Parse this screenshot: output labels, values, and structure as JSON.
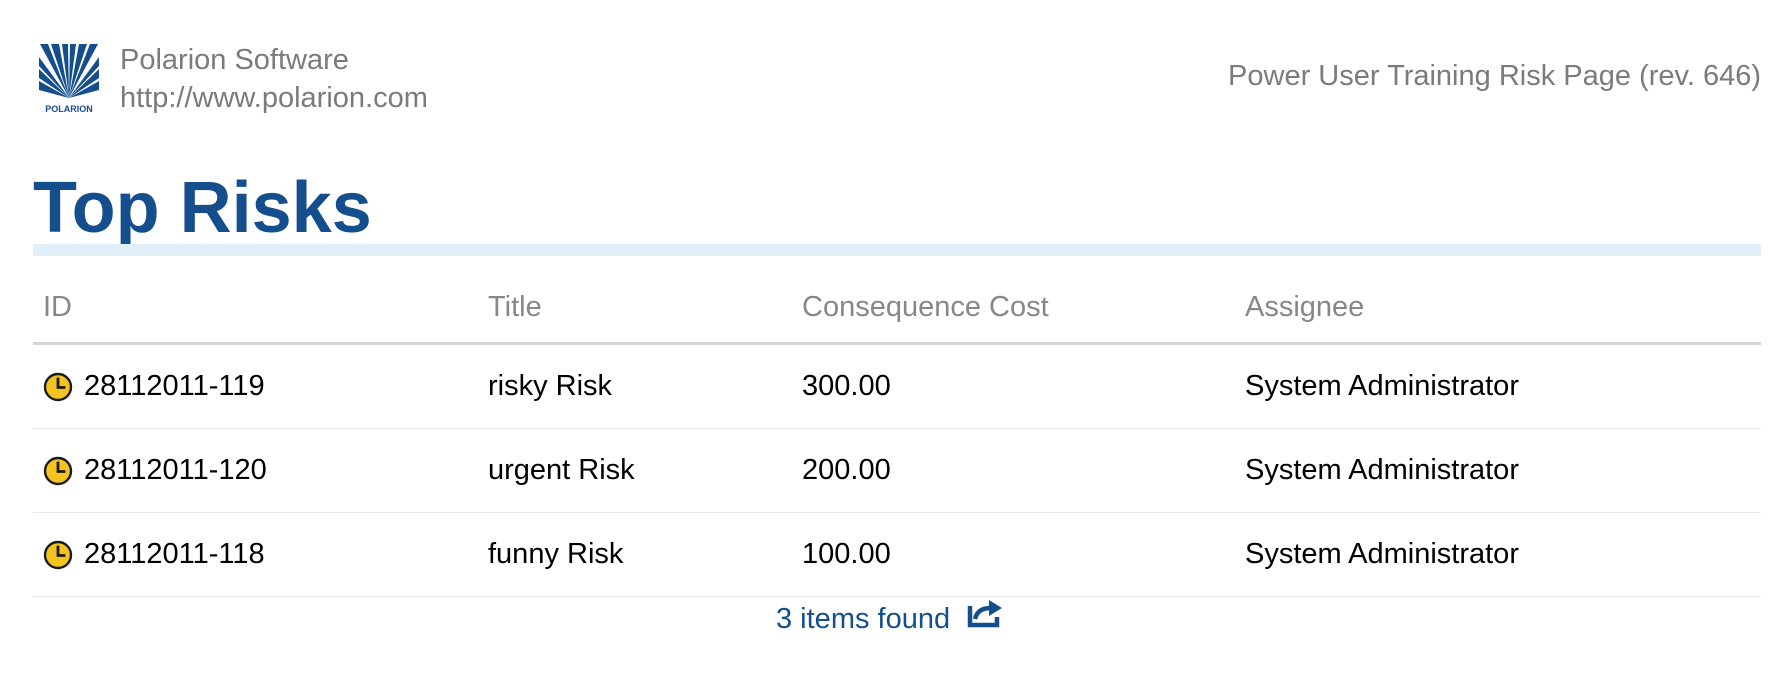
{
  "header": {
    "logo": {
      "icon": "polarion-logo-icon",
      "text": "POLARION",
      "color": "#154e8c"
    },
    "company_name": "Polarion Software",
    "company_url": "http://www.polarion.com",
    "page_reference": "Power User Training Risk Page (rev. 646)"
  },
  "main": {
    "title": "Top Risks",
    "table": {
      "columns": [
        "ID",
        "Title",
        "Consequence Cost",
        "Assignee"
      ],
      "rows": [
        {
          "icon": "clock-icon",
          "id": "28112011-119",
          "title": "risky Risk",
          "cost": "300.00",
          "assignee": "System Administrator"
        },
        {
          "icon": "clock-icon",
          "id": "28112011-120",
          "title": "urgent Risk",
          "cost": "200.00",
          "assignee": "System Administrator"
        },
        {
          "icon": "clock-icon",
          "id": "28112011-118",
          "title": "funny Risk",
          "cost": "100.00",
          "assignee": "System Administrator"
        }
      ]
    },
    "footer": {
      "items_found": "3 items found",
      "export_icon": "export-icon"
    }
  },
  "colors": {
    "title_blue": "#154e8c",
    "title_rule": "#e1effb",
    "header_text": "#878787",
    "clock_icon": "#f3c31f"
  }
}
